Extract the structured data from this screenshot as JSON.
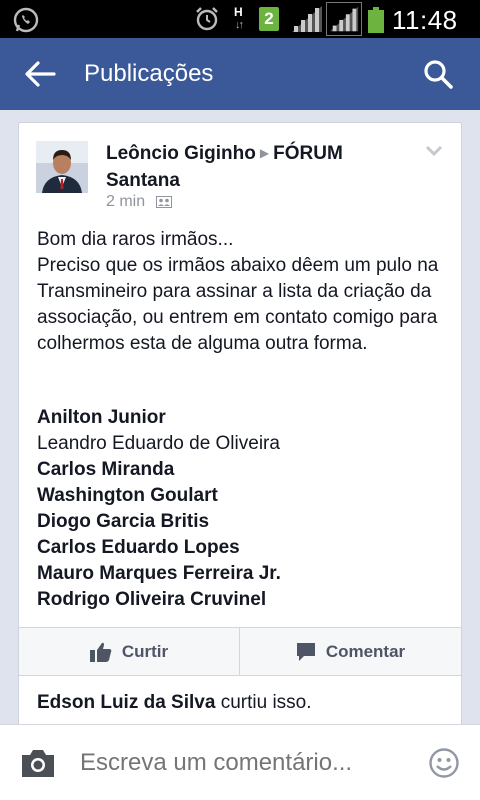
{
  "status_bar": {
    "time": "11:48",
    "sim_slot": "2",
    "network_letter": "H",
    "icons": [
      "whatsapp-icon",
      "alarm-icon",
      "network-h-icon",
      "sim-2-icon",
      "signal-icon",
      "signal-icon-2",
      "battery-icon"
    ]
  },
  "app_bar": {
    "title": "Publicações",
    "back_icon": "back-arrow-icon",
    "search_icon": "search-icon"
  },
  "post": {
    "author": "Leôncio Giginho",
    "group": "FÓRUM Santana",
    "time": "2 min",
    "text_lines": [
      "Bom dia raros irmãos...",
      "Preciso que os irmãos abaixo dêem um pulo na Transmineiro para assinar a lista da criação da associação, ou entrem em contato comigo para colhermos esta de alguma outra forma."
    ],
    "names": [
      {
        "name": "Anilton Junior",
        "bold": true
      },
      {
        "name": "Leandro Eduardo de Oliveira",
        "bold": false
      },
      {
        "name": "Carlos Miranda",
        "bold": true
      },
      {
        "name": "Washington Goulart",
        "bold": true
      },
      {
        "name": "Diogo Garcia Britis",
        "bold": true
      },
      {
        "name": "Carlos Eduardo Lopes",
        "bold": true
      },
      {
        "name": "Mauro Marques Ferreira Jr.",
        "bold": true
      },
      {
        "name": "Rodrigo Oliveira Cruvinel",
        "bold": true
      }
    ],
    "actions": {
      "like_label": "Curtir",
      "comment_label": "Comentar"
    },
    "likes": {
      "who": "Edson Luiz da Silva",
      "suffix": "curtiu isso."
    }
  },
  "comment_bar": {
    "placeholder": "Escreva um comentário...",
    "icons": [
      "camera-icon",
      "emoji-icon"
    ]
  },
  "colors": {
    "brand": "#3b5998",
    "background": "#dfe3ee",
    "action_text": "#4e5665",
    "meta_text": "#90949c"
  }
}
